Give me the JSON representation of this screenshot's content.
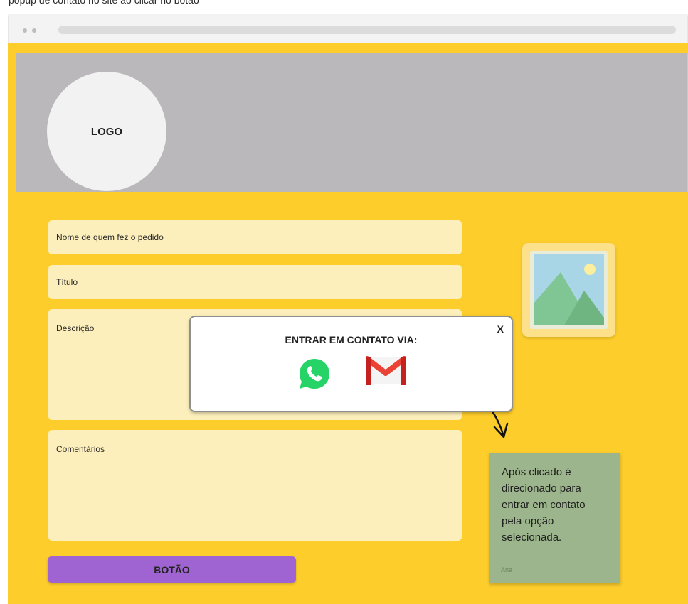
{
  "top_caption": "popup de contato no site ao clicar no botão",
  "header": {
    "logo_label": "LOGO"
  },
  "form": {
    "nome_placeholder": "Nome de quem fez o pedido",
    "titulo_placeholder": "Título",
    "descricao_placeholder": "Descrição",
    "comentarios_placeholder": "Comentários",
    "button_label": "BOTÃO"
  },
  "modal": {
    "title": "ENTRAR EM CONTATO VIA:",
    "close_label": "X",
    "options": [
      {
        "icon": "whatsapp-icon",
        "color": "#25d366"
      },
      {
        "icon": "gmail-icon",
        "color": "#ea4335"
      }
    ]
  },
  "sticky_note": {
    "text": "Após clicado é direcionado para entrar em contato pela opção selecionada.",
    "author": "Ana"
  },
  "colors": {
    "page_background": "#fdcd2b",
    "header_band": "#bbb8bc",
    "field_background": "#fdefbb",
    "button": "#a064d2",
    "sticky_note": "#9cb58c"
  }
}
